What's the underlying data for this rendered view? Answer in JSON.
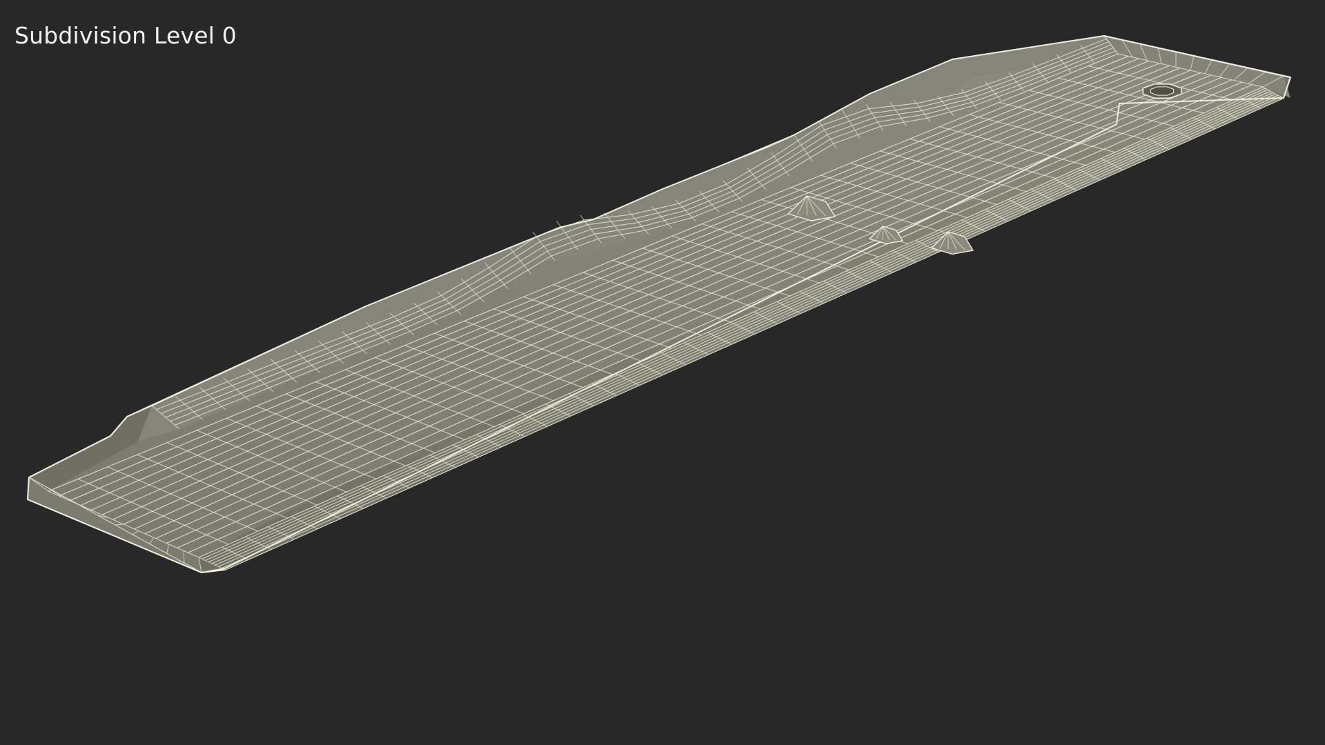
{
  "viewport": {
    "overlay_label": "Subdivision Level 0",
    "background_color": "#282828"
  },
  "model": {
    "object": "mini-golf-lane",
    "display_mode": "wireframe-on-shaded",
    "surface_color": "#7e7e72",
    "wire_color": "#eeeede",
    "features": [
      "rounded-rim",
      "double-ramp",
      "cup-hole",
      "bumper-obstacles"
    ]
  }
}
